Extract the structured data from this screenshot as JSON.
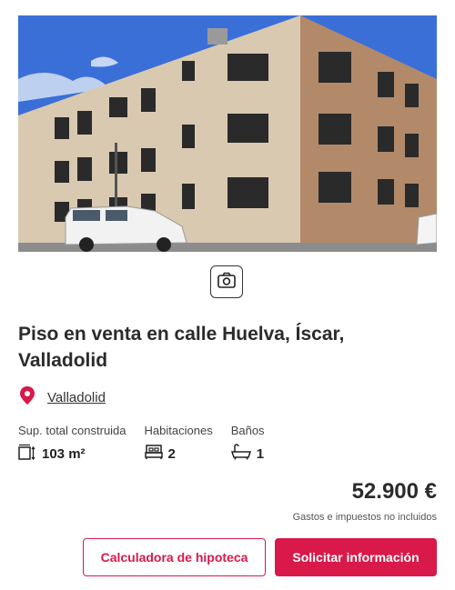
{
  "listing": {
    "title": "Piso en venta en calle Huelva, Íscar, Valladolid",
    "location_link": "Valladolid",
    "price": "52.900 €",
    "taxes_note": "Gastos e impuestos no incluidos"
  },
  "features": [
    {
      "label": "Sup. total construida",
      "value": "103 m²",
      "icon": "area-icon"
    },
    {
      "label": "Habitaciones",
      "value": "2",
      "icon": "bed-icon"
    },
    {
      "label": "Baños",
      "value": "1",
      "icon": "bathtub-icon"
    }
  ],
  "actions": {
    "mortgage_calculator": "Calculadora de hipoteca",
    "request_info": "Solicitar información"
  },
  "colors": {
    "accent": "#d8194a",
    "text": "#2b2b2b"
  },
  "icons": {
    "gallery": "camera-icon",
    "location": "map-pin-icon"
  }
}
